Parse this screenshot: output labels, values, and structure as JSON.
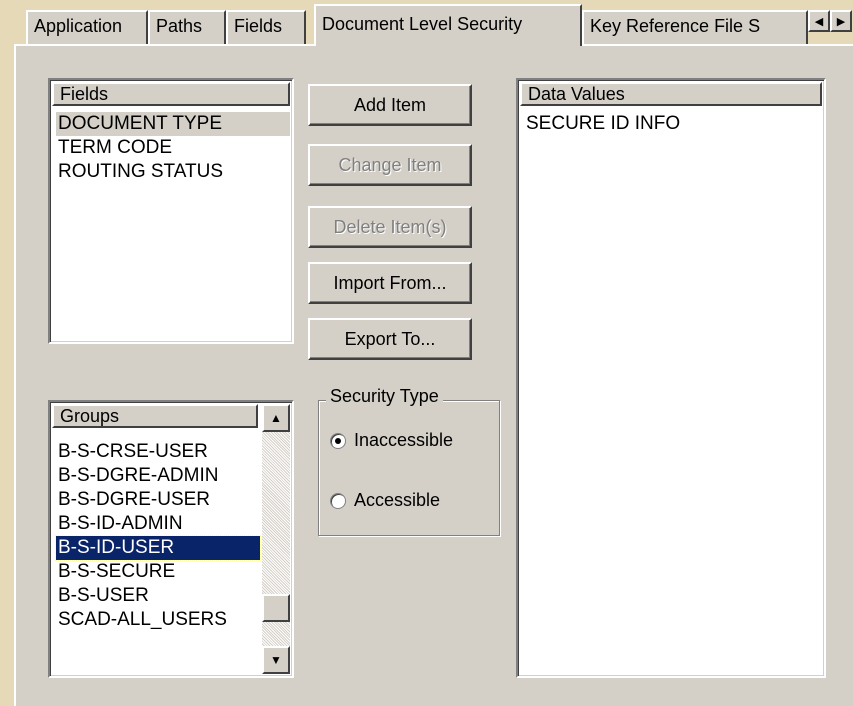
{
  "tabs": [
    {
      "label": "Application"
    },
    {
      "label": "Paths"
    },
    {
      "label": "Fields"
    },
    {
      "label": "Document Level Security"
    },
    {
      "label": "Key Reference File S"
    }
  ],
  "fields": {
    "header": "Fields",
    "items": [
      "DOCUMENT TYPE",
      "TERM CODE",
      "ROUTING STATUS"
    ]
  },
  "buttons": {
    "add_item": "Add Item",
    "change_item": "Change Item",
    "delete_items": "Delete Item(s)",
    "import_from": "Import From...",
    "export_to": "Export To..."
  },
  "data_values": {
    "header": "Data Values",
    "items": [
      "SECURE ID INFO"
    ]
  },
  "groups": {
    "header": "Groups",
    "items": [
      "B-S-CRSE-USER",
      "B-S-DGRE-ADMIN",
      "B-S-DGRE-USER",
      "B-S-ID-ADMIN",
      "B-S-ID-USER",
      "B-S-SECURE",
      "B-S-USER",
      "SCAD-ALL_USERS"
    ],
    "selected": "B-S-ID-USER"
  },
  "security_type": {
    "title": "Security Type",
    "options": [
      "Inaccessible",
      "Accessible"
    ],
    "selected": "Inaccessible"
  },
  "icons": {
    "scroll_left": "scroll-left-arrow-icon",
    "scroll_right": "scroll-right-arrow-icon",
    "scroll_up": "scroll-up-arrow-icon",
    "scroll_down": "scroll-down-arrow-icon"
  },
  "colors": {
    "background": "#e6d9b8",
    "dialog": "#d4d0c8",
    "selection": "#0a246a"
  }
}
